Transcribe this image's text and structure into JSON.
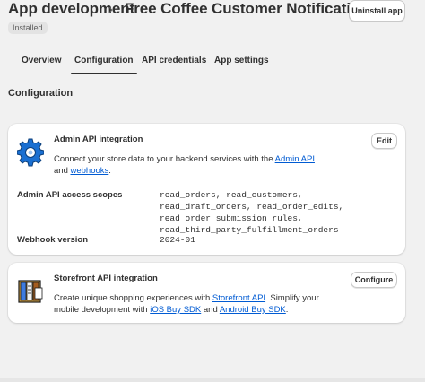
{
  "header": {
    "breadcrumb": "App development",
    "separator": "›",
    "title": "Free Coffee Customer Notification",
    "uninstall_label": "Uninstall app",
    "badge": "Installed"
  },
  "tabs": [
    {
      "label": "Overview",
      "active": false
    },
    {
      "label": "Configuration",
      "active": true
    },
    {
      "label": "API credentials",
      "active": false
    },
    {
      "label": "App settings",
      "active": false
    }
  ],
  "section_title": "Configuration",
  "admin_card": {
    "icon": "gear-icon",
    "title": "Admin API integration",
    "edit_label": "Edit",
    "desc_pre": "Connect your store data to your backend services with the ",
    "link_admin_api": "Admin API",
    "desc_mid": " and ",
    "link_webhooks": "webhooks",
    "desc_post": ".",
    "scopes_label": "Admin API access scopes",
    "scopes_value": "read_orders, read_customers, read_draft_orders, read_order_edits, read_order_submission_rules, read_third_party_fulfillment_orders",
    "webhook_label": "Webhook version",
    "webhook_value": "2024-01"
  },
  "storefront_card": {
    "icon": "storefront-icon",
    "title": "Storefront API integration",
    "configure_label": "Configure",
    "desc_pre": "Create unique shopping experiences with ",
    "link_storefront_api": "Storefront API",
    "desc_mid": ". Simplify your mobile development with ",
    "link_ios_sdk": "iOS Buy SDK",
    "desc_and": " and ",
    "link_android_sdk": "Android Buy SDK",
    "desc_post": "."
  },
  "colors": {
    "background": "#f1f1f1",
    "card": "#ffffff",
    "link": "#005bd3",
    "text": "#303030"
  }
}
